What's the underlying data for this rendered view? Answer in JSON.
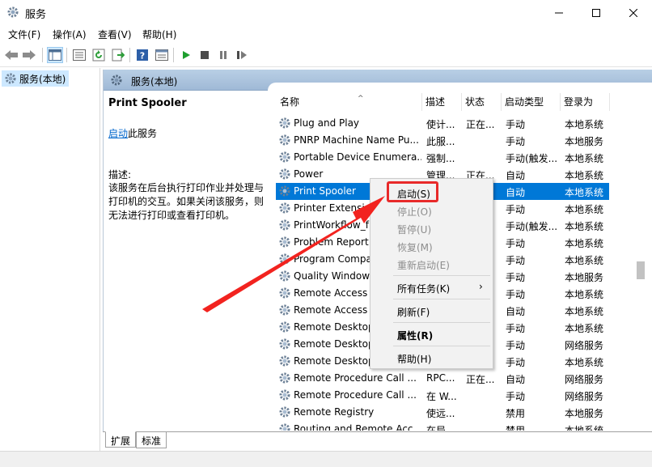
{
  "window": {
    "title": "服务",
    "icon": "gear-icon"
  },
  "menu": [
    "文件(F)",
    "操作(A)",
    "查看(V)",
    "帮助(H)"
  ],
  "tree": {
    "root_label": "服务(本地)"
  },
  "panel": {
    "header_title": "服务(本地)"
  },
  "detail": {
    "service_name": "Print Spooler",
    "start_link": "启动",
    "start_suffix": "此服务",
    "desc_label": "描述:",
    "desc_text": "该服务在后台执行打印作业并处理与打印机的交互。如果关闭该服务，则无法进行打印或查看打印机。"
  },
  "columns": {
    "name": "名称",
    "desc": "描述",
    "status": "状态",
    "start_type": "启动类型",
    "logon": "登录为"
  },
  "services": [
    {
      "name": "Plug and Play",
      "desc": "使计...",
      "status": "正在...",
      "start_type": "手动",
      "logon": "本地系统"
    },
    {
      "name": "PNRP Machine Name Pu...",
      "desc": "此服...",
      "status": "",
      "start_type": "手动",
      "logon": "本地服务"
    },
    {
      "name": "Portable Device Enumera...",
      "desc": "强制...",
      "status": "",
      "start_type": "手动(触发...",
      "logon": "本地系统"
    },
    {
      "name": "Power",
      "desc": "管理...",
      "status": "正在...",
      "start_type": "自动",
      "logon": "本地系统"
    },
    {
      "name": "Print Spooler",
      "desc": "",
      "status": "",
      "start_type": "自动",
      "logon": "本地系统"
    },
    {
      "name": "Printer Extensi",
      "desc": "",
      "status": "",
      "start_type": "手动",
      "logon": "本地系统"
    },
    {
      "name": "PrintWorkflow_f",
      "desc": "",
      "status": "",
      "start_type": "手动(触发...",
      "logon": "本地系统"
    },
    {
      "name": "Problem Report",
      "desc": "",
      "status": "",
      "start_type": "手动",
      "logon": "本地系统"
    },
    {
      "name": "Program Compa",
      "desc": "",
      "status": "",
      "start_type": "手动",
      "logon": "本地系统"
    },
    {
      "name": "Quality Windows",
      "desc": "",
      "status": "",
      "start_type": "手动",
      "logon": "本地服务"
    },
    {
      "name": "Remote Access",
      "desc": "",
      "status": "",
      "start_type": "手动",
      "logon": "本地系统"
    },
    {
      "name": "Remote Access",
      "desc": "",
      "status": "",
      "start_type": "自动",
      "logon": "本地系统"
    },
    {
      "name": "Remote Desktop",
      "desc": "",
      "status": "",
      "start_type": "手动",
      "logon": "本地系统"
    },
    {
      "name": "Remote Desktop",
      "desc": "",
      "status": "",
      "start_type": "手动",
      "logon": "网络服务"
    },
    {
      "name": "Remote Desktop",
      "desc": "",
      "status": "",
      "start_type": "手动",
      "logon": "本地系统"
    },
    {
      "name": "Remote Procedure Call ...",
      "desc": "RPC...",
      "status": "正在...",
      "start_type": "自动",
      "logon": "网络服务"
    },
    {
      "name": "Remote Procedure Call ...",
      "desc": "在 W...",
      "status": "",
      "start_type": "手动",
      "logon": "网络服务"
    },
    {
      "name": "Remote Registry",
      "desc": "使远...",
      "status": "",
      "start_type": "禁用",
      "logon": "本地服务"
    },
    {
      "name": "Routing and Remote Acc...",
      "desc": "在局...",
      "status": "",
      "start_type": "禁用",
      "logon": "本地系统"
    }
  ],
  "context_menu": {
    "start": "启动(S)",
    "stop": "停止(O)",
    "pause": "暂停(U)",
    "resume": "恢复(M)",
    "restart": "重新启动(E)",
    "all_tasks": "所有任务(K)",
    "refresh": "刷新(F)",
    "properties": "属性(R)",
    "help": "帮助(H)"
  },
  "tabs": [
    "扩展",
    "标准"
  ],
  "colors": {
    "selection": "#0078d7",
    "annotation": "#e82a2a",
    "link": "#0066cc"
  }
}
